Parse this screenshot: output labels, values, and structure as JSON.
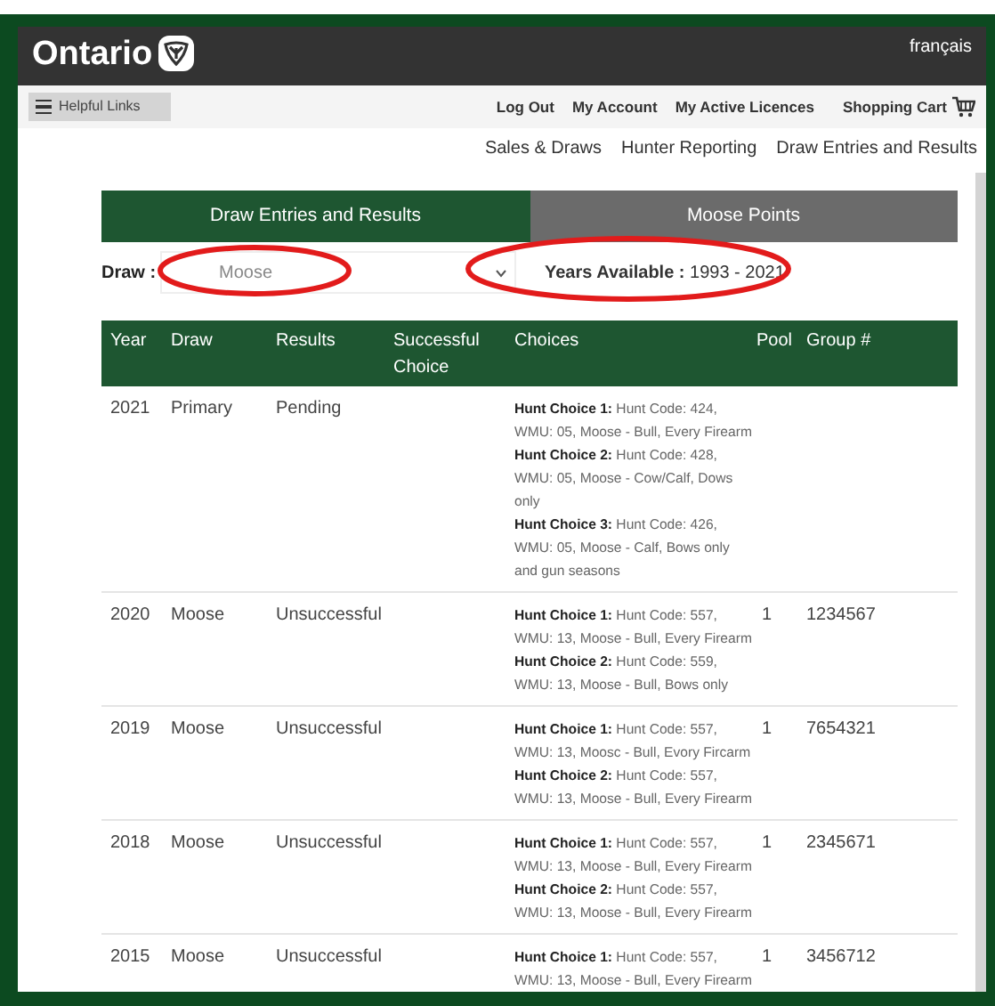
{
  "header": {
    "logo": "Ontario",
    "language_link": "français"
  },
  "nav": {
    "menu_button": "Helpful Links",
    "links": [
      "Log Out",
      "My Account",
      "My Active Licences"
    ],
    "cart": "Shopping Cart"
  },
  "subnav": [
    "Sales & Draws",
    "Hunter Reporting",
    "Draw Entries and Results"
  ],
  "tabs": [
    {
      "label": "Draw Entries and Results",
      "selected": true
    },
    {
      "label": "Moose Points",
      "selected": false
    }
  ],
  "filter": {
    "label": "Draw :",
    "value": "Moose",
    "years_label": "Years Available :",
    "years": "1993 - 2021"
  },
  "table": {
    "columns": [
      "Year",
      "Draw",
      "Results",
      "Successful Choice",
      "Choices",
      "Pool",
      "Group #"
    ],
    "rows": [
      {
        "year": "2021",
        "draw": "Primary",
        "results": "Pending",
        "choices": [
          "**Hunt Choice 1:** Hunt Code: 424, WMU: 05, Moose - Bull, Every Firearm",
          "**Hunt Choice 2:** Hunt Code: 428, WMU: 05, Moose - Cow/Calf, Dows only",
          "**Hunt Choice 3:** Hunt Code: 426, WMU: 05, Moose - Calf, Bows only and gun seasons"
        ]
      },
      {
        "year": "2020",
        "draw": "Moose",
        "results": "Unsuccessful",
        "choices": [
          "**Hunt Choice 1:** Hunt Code: 557, WMU: 13, Moose - Bull, Every Firearm",
          "**Hunt Choice 2:** Hunt Code: 559, WMU: 13, Moose - Bull, Bows only"
        ],
        "pool": "1",
        "group": "1234567"
      },
      {
        "year": "2019",
        "draw": "Moose",
        "results": "Unsuccessful",
        "choices": [
          "**Hunt Choice 1:** Hunt Code: 557, WMU: 13, Moosc - Bull, Evory Fircarm",
          "**Hunt Choice 2:** Hunt Code: 557, WMU: 13, Moose - Bull, Every Firearm"
        ],
        "pool": "1",
        "group": "7654321"
      },
      {
        "year": "2018",
        "draw": "Moose",
        "results": "Unsuccessful",
        "choices": [
          "**Hunt Choice 1:** Hunt Code: 557, WMU: 13, Moose - Bull, Every Firearm",
          "**Hunt Choice 2:** Hunt Code: 557, WMU: 13, Moose - Bull, Every Firearm"
        ],
        "pool": "1",
        "group": "2345671"
      },
      {
        "year": "2015",
        "draw": "Moose",
        "results": "Unsuccessful",
        "choices": [
          "**Hunt Choice 1:** Hunt Code: 557, WMU: 13, Moose - Bull, Every Firearm"
        ],
        "pool": "1",
        "group": "3456712"
      }
    ]
  }
}
